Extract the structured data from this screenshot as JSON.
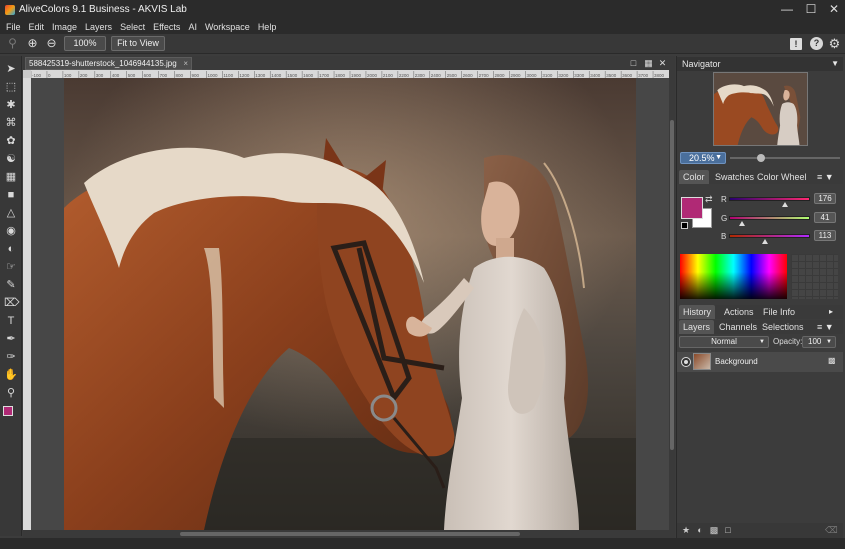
{
  "window": {
    "title": "AliveColors 9.1 Business - AKVIS Lab",
    "minimize_icon": "minimize-icon",
    "maximize_icon": "maximize-icon",
    "close_icon": "close-icon"
  },
  "menu": [
    "File",
    "Edit",
    "Image",
    "Layers",
    "Select",
    "Effects",
    "AI",
    "Workspace",
    "Help"
  ],
  "toolbar": {
    "zoom_value": "100%",
    "fit_label": "Fit to View"
  },
  "document": {
    "tab_name": "588425319-shutterstock_1046944135.jpg",
    "close_glyph": "×",
    "ruler_ticks": [
      "-100",
      "0",
      "100",
      "200",
      "300",
      "400",
      "500",
      "600",
      "700",
      "800",
      "900",
      "1000",
      "1100",
      "1200",
      "1300",
      "1400",
      "1500",
      "1600",
      "1700",
      "1800",
      "1900",
      "2000",
      "2100",
      "2200",
      "2300",
      "2400",
      "2500",
      "2600",
      "2700",
      "2800",
      "2900",
      "3000",
      "3100",
      "3200",
      "3300",
      "3400",
      "3500",
      "3600",
      "3700",
      "3800"
    ]
  },
  "navigator": {
    "title": "Navigator",
    "zoom": "20.5%",
    "zoom_slider_level": 0.28
  },
  "color_panel": {
    "tabs": [
      "Color",
      "Swatches",
      "Color Wheel"
    ],
    "active_tab": "Color",
    "foreground": "#b02975",
    "background": "#ffffff",
    "channels": [
      {
        "label": "R",
        "value": "176",
        "level": 0.69
      },
      {
        "label": "G",
        "value": "41",
        "level": 0.16
      },
      {
        "label": "B",
        "value": "113",
        "level": 0.44
      }
    ]
  },
  "history_panel": {
    "tabs": [
      "History",
      "Actions",
      "File Info"
    ],
    "active_tab": "History"
  },
  "layers_panel": {
    "tabs": [
      "Layers",
      "Channels",
      "Selections"
    ],
    "active_tab": "Layers",
    "blend_mode": "Normal",
    "opacity_label": "Opacity:",
    "opacity_value": "100",
    "layers": [
      {
        "name": "Background",
        "visible": true,
        "locked": true
      }
    ]
  },
  "accent_colors": {
    "active_blue": "#4a6f9c",
    "panel_bg": "#3c3c3c",
    "titlebar_bg": "#2b2b2b"
  }
}
